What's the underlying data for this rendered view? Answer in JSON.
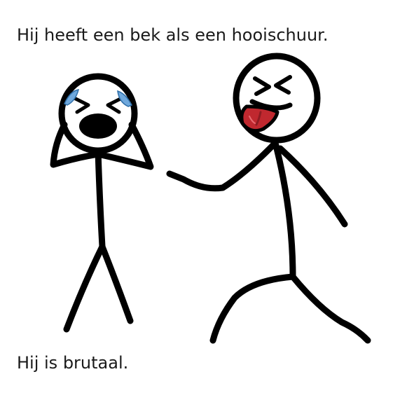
{
  "captions": {
    "top": "Hij heeft een bek als een hooischuur.",
    "bottom": "Hij is brutaal."
  },
  "illustration": {
    "figures": [
      {
        "role": "crying-stick-figure",
        "icons": [
          "tear-icon",
          "tear-icon",
          "open-mouth-icon"
        ]
      },
      {
        "role": "laughing-stick-figure",
        "icons": [
          "squint-eyes-icon",
          "tongue-out-icon"
        ]
      }
    ],
    "colors": {
      "stroke": "#000000",
      "tears": "#6fa8dc",
      "tongue": "#c0282f",
      "tongue_dark": "#8e1c22",
      "background": "#ffffff"
    }
  }
}
